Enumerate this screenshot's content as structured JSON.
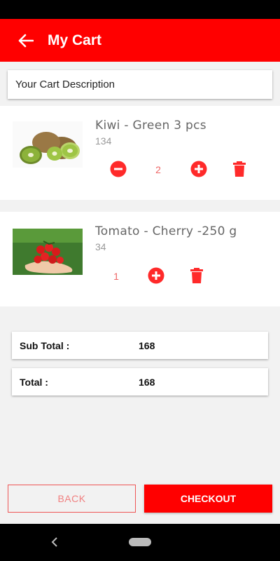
{
  "app_bar": {
    "title": "My Cart"
  },
  "cart": {
    "description": "Your Cart Description"
  },
  "items": [
    {
      "name": "Kiwi - Green 3 pcs",
      "price": "134",
      "quantity": "2"
    },
    {
      "name": "Tomato - Cherry -250 g",
      "price": "34",
      "quantity": "1"
    }
  ],
  "totals": {
    "subtotal_label": "Sub Total :",
    "subtotal_value": "168",
    "total_label": "Total :",
    "total_value": "168"
  },
  "buttons": {
    "back": "BACK",
    "checkout": "CHECKOUT"
  },
  "colors": {
    "accent": "#ff0000",
    "background": "#f2f2f2"
  },
  "icons": [
    "back-arrow-icon",
    "minus-circle-icon",
    "plus-circle-icon",
    "trash-icon",
    "nav-back-icon",
    "nav-home-icon"
  ]
}
